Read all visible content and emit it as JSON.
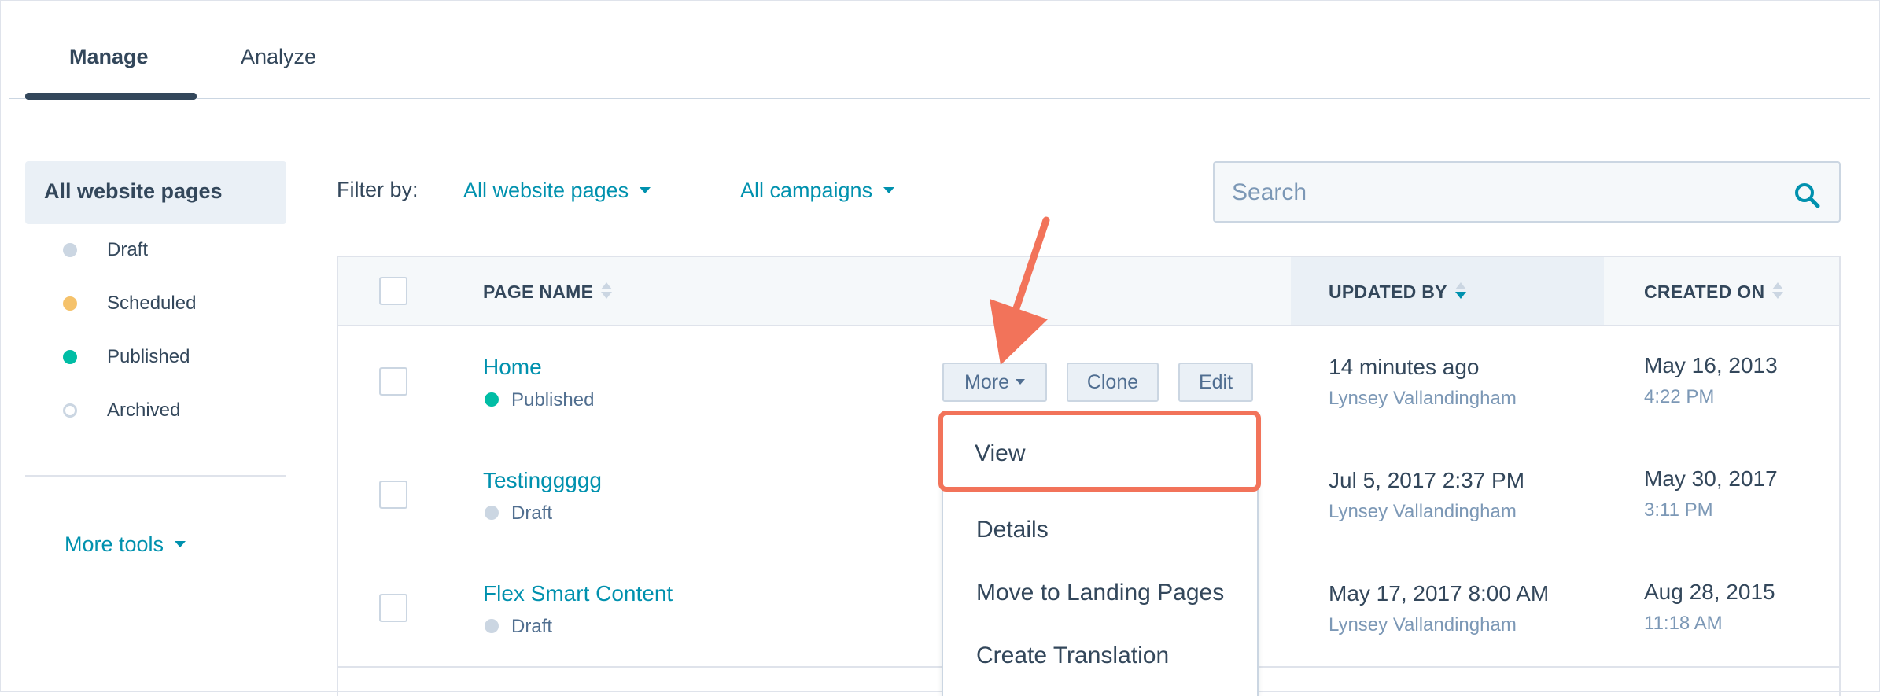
{
  "tabs": {
    "manage": "Manage",
    "analyze": "Analyze"
  },
  "sidebar": {
    "active": "All website pages",
    "items": [
      {
        "label": "Draft",
        "color": "#cbd6e2"
      },
      {
        "label": "Scheduled",
        "color": "#f5c26b"
      },
      {
        "label": "Published",
        "color": "#00bda5"
      },
      {
        "label": "Archived",
        "color": "#ffffff"
      }
    ],
    "more_tools": "More tools"
  },
  "filter": {
    "label": "Filter by:",
    "pages": "All website pages",
    "campaigns": "All campaigns"
  },
  "search": {
    "placeholder": "Search"
  },
  "table": {
    "headers": {
      "page_name": "PAGE NAME",
      "updated_by": "UPDATED BY",
      "created_on": "CREATED ON"
    },
    "rows": [
      {
        "name": "Home",
        "status": "Published",
        "status_color": "#00bda5",
        "updated": "14 minutes ago",
        "updated_by": "Lynsey Vallandingham",
        "created_date": "May 16, 2013",
        "created_time": "4:22 PM"
      },
      {
        "name": "Testinggggg",
        "status": "Draft",
        "status_color": "#cbd6e2",
        "updated": "Jul 5, 2017 2:37 PM",
        "updated_by": "Lynsey Vallandingham",
        "created_date": "May 30, 2017",
        "created_time": "3:11 PM"
      },
      {
        "name": "Flex Smart Content",
        "status": "Draft",
        "status_color": "#cbd6e2",
        "updated": "May 17, 2017 8:00 AM",
        "updated_by": "Lynsey Vallandingham",
        "created_date": "Aug 28, 2015",
        "created_time": "11:18 AM"
      }
    ]
  },
  "row_actions": {
    "more": "More",
    "clone": "Clone",
    "edit": "Edit"
  },
  "menu": {
    "items": [
      "View",
      "Details",
      "Move to Landing Pages",
      "Create Translation"
    ]
  },
  "colors": {
    "accent": "#0091ae",
    "highlight": "#f2735a"
  }
}
